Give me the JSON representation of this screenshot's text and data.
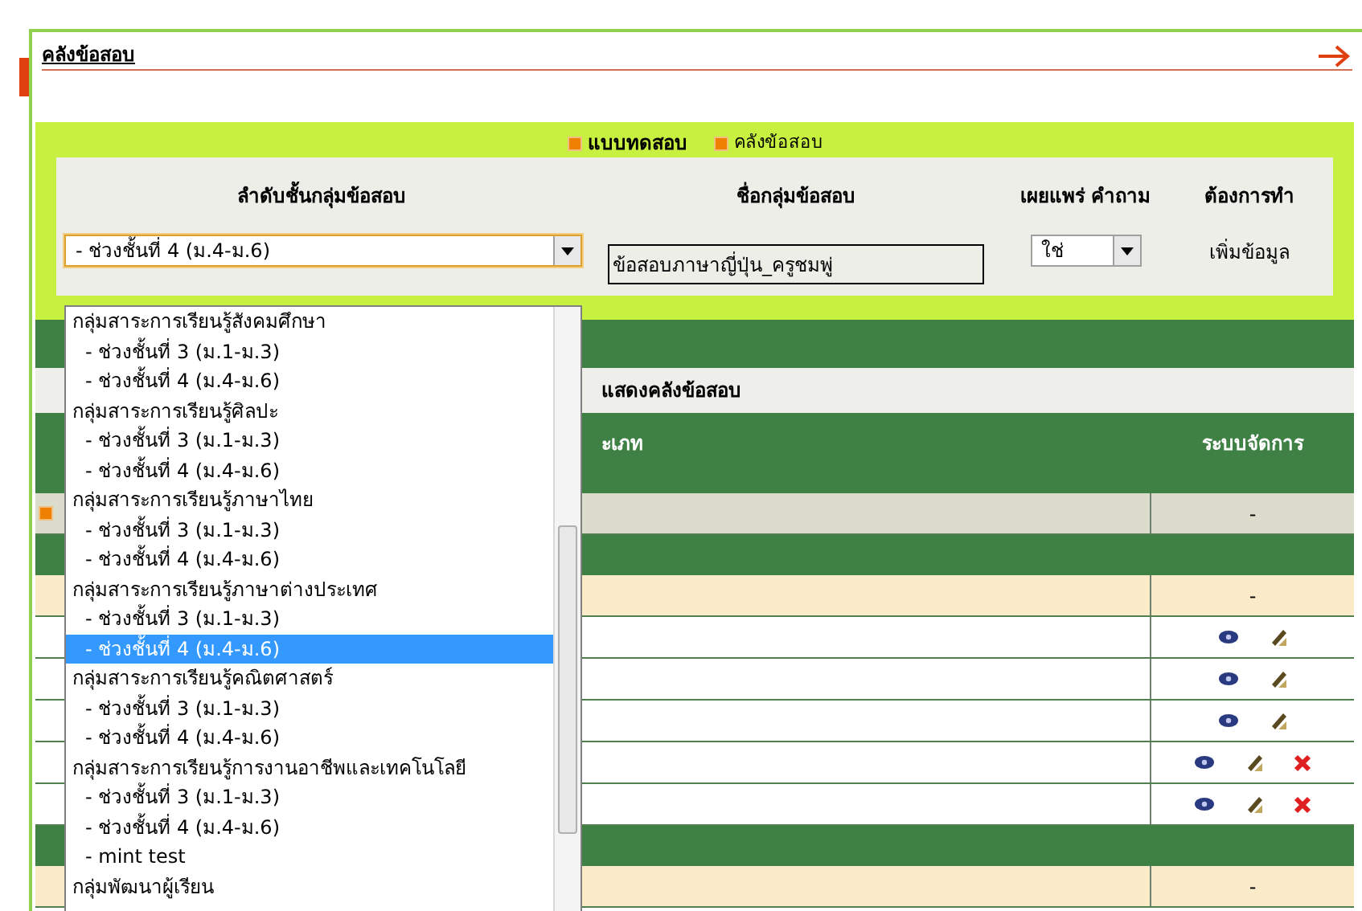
{
  "page": {
    "title": "คลังข้อสอบ"
  },
  "nav_links": [
    {
      "label": "แบบทดสอบ",
      "selected": true
    },
    {
      "label": "คลังข้อสอบ",
      "selected": false
    }
  ],
  "form": {
    "columns": [
      "ลำดับชั้นกลุ่มข้อสอบ",
      "ชื่อกลุ่มข้อสอบ",
      "เผยแพร่ คำถาม",
      "ต้องการทำ"
    ],
    "level_select": {
      "value": "- ช่วงชั้นที่ 4 (ม.4-ม.6)",
      "expanded": true
    },
    "group_name": {
      "value": "ข้อสอบภาษาญี่ปุ่น_ครูชมพู่"
    },
    "publish_select": {
      "value": "ใช่"
    },
    "action": "เพิ่มข้อมูล"
  },
  "dropdown": {
    "options": [
      {
        "label": "กลุ่มสาระการเรียนรู้สังคมศึกษา",
        "kind": "group",
        "selected": false
      },
      {
        "label": "- ช่วงชั้นที่ 3 (ม.1-ม.3)",
        "kind": "level",
        "selected": false
      },
      {
        "label": "- ช่วงชั้นที่ 4 (ม.4-ม.6)",
        "kind": "level",
        "selected": false
      },
      {
        "label": "กลุ่มสาระการเรียนรู้ศิลปะ",
        "kind": "group",
        "selected": false
      },
      {
        "label": "- ช่วงชั้นที่ 3 (ม.1-ม.3)",
        "kind": "level",
        "selected": false
      },
      {
        "label": "- ช่วงชั้นที่ 4 (ม.4-ม.6)",
        "kind": "level",
        "selected": false
      },
      {
        "label": "กลุ่มสาระการเรียนรู้ภาษาไทย",
        "kind": "group",
        "selected": false
      },
      {
        "label": "- ช่วงชั้นที่ 3 (ม.1-ม.3)",
        "kind": "level",
        "selected": false
      },
      {
        "label": "- ช่วงชั้นที่ 4 (ม.4-ม.6)",
        "kind": "level",
        "selected": false
      },
      {
        "label": "กลุ่มสาระการเรียนรู้ภาษาต่างประเทศ",
        "kind": "group",
        "selected": false
      },
      {
        "label": "- ช่วงชั้นที่ 3 (ม.1-ม.3)",
        "kind": "level",
        "selected": false
      },
      {
        "label": "- ช่วงชั้นที่ 4 (ม.4-ม.6)",
        "kind": "level",
        "selected": true
      },
      {
        "label": "กลุ่มสาระการเรียนรู้คณิตศาสตร์",
        "kind": "group",
        "selected": false
      },
      {
        "label": "- ช่วงชั้นที่ 3 (ม.1-ม.3)",
        "kind": "level",
        "selected": false
      },
      {
        "label": "- ช่วงชั้นที่ 4 (ม.4-ม.6)",
        "kind": "level",
        "selected": false
      },
      {
        "label": "กลุ่มสาระการเรียนรู้การงานอาชีพและเทคโนโลยี",
        "kind": "group",
        "selected": false
      },
      {
        "label": "- ช่วงชั้นที่ 3 (ม.1-ม.3)",
        "kind": "level",
        "selected": false
      },
      {
        "label": "- ช่วงชั้นที่ 4 (ม.4-ม.6)",
        "kind": "level",
        "selected": false
      },
      {
        "label": "- mint test",
        "kind": "level",
        "selected": false
      },
      {
        "label": "กลุ่มพัฒนาผู้เรียน",
        "kind": "group",
        "selected": false
      }
    ]
  },
  "bank": {
    "title": "แสดงคลังข้อสอบ",
    "columns": [
      "ะเภท",
      "ระบบจัดการ"
    ],
    "rows": [
      {
        "kind": "folder",
        "manage": "-"
      },
      {
        "kind": "band"
      },
      {
        "kind": "category",
        "manage": "-"
      },
      {
        "kind": "entry",
        "deletable": false
      },
      {
        "kind": "entry",
        "deletable": false
      },
      {
        "kind": "entry",
        "deletable": false
      },
      {
        "kind": "entry",
        "deletable": true
      },
      {
        "kind": "entry",
        "deletable": true
      },
      {
        "kind": "band"
      },
      {
        "kind": "category",
        "manage": "-"
      }
    ]
  }
}
